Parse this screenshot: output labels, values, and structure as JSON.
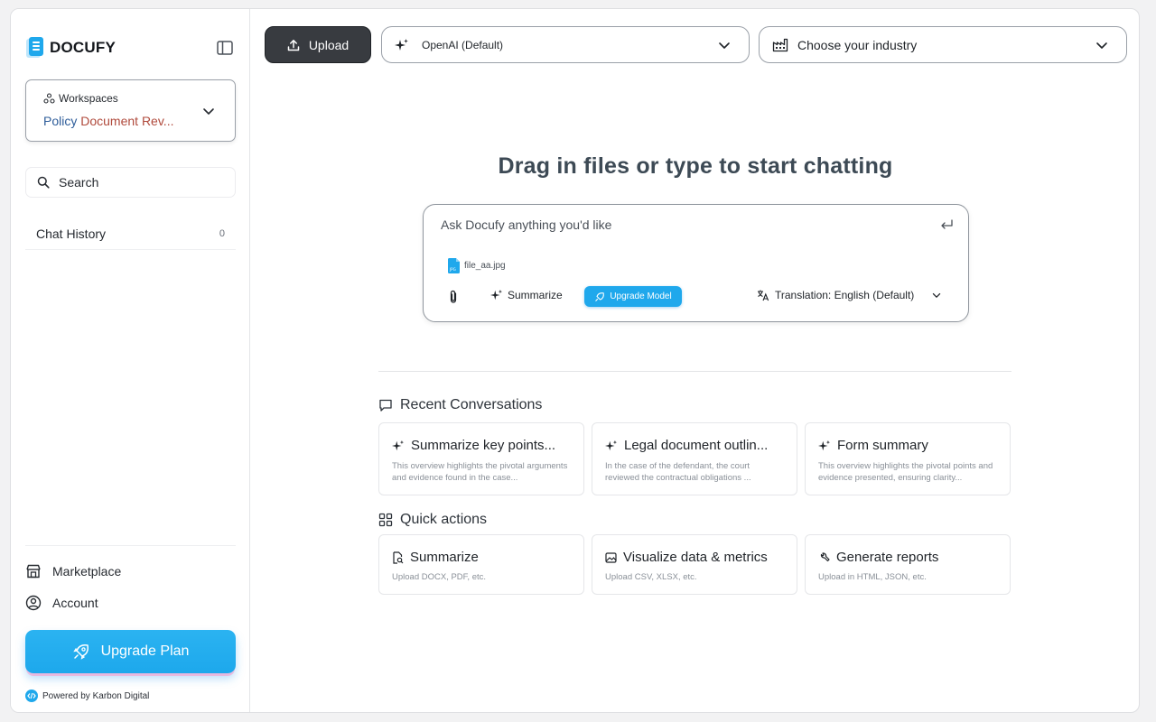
{
  "brand": {
    "name": "DOCUFY"
  },
  "workspace": {
    "label": "Workspaces",
    "name_part1": "Policy",
    "name_part2": "Document Rev..."
  },
  "search": {
    "label": "Search"
  },
  "chat_history": {
    "label": "Chat History",
    "count": "0"
  },
  "nav": {
    "marketplace": "Marketplace",
    "account": "Account"
  },
  "upgrade_plan": {
    "label": "Upgrade Plan"
  },
  "powered_by": "Powered by Karbon Digital",
  "toolbar": {
    "upload_label": "Upload",
    "model_value": "OpenAI (Default)",
    "industry_value": "Choose your industry"
  },
  "headline": "Drag in files or type to start chatting",
  "composer": {
    "placeholder": "Ask Docufy anything you'd like",
    "attachment_name": "file_aa.jpg",
    "summarize_label": "Summarize",
    "upgrade_model_label": "Upgrade Model",
    "translation_label": "Translation: English (Default)"
  },
  "recent": {
    "title": "Recent Conversations",
    "cards": [
      {
        "title": "Summarize key points...",
        "desc": "This overview highlights the pivotal arguments and evidence found in the case..."
      },
      {
        "title": "Legal document outlin...",
        "desc": "In the case of the defendant, the court reviewed the contractual obligations ..."
      },
      {
        "title": "Form summary",
        "desc": "This overview highlights the pivotal points and evidence presented, ensuring clarity..."
      }
    ]
  },
  "quick_actions": {
    "title": "Quick actions",
    "cards": [
      {
        "title": "Summarize",
        "desc": "Upload DOCX, PDF, etc.",
        "icon": "doc-search-icon"
      },
      {
        "title": "Visualize data & metrics",
        "desc": "Upload CSV, XLSX, etc.",
        "icon": "image-icon"
      },
      {
        "title": "Generate reports",
        "desc": "Upload in HTML, JSON, etc.",
        "icon": "wrench-icon"
      }
    ]
  },
  "colors": {
    "accent": "#1fa8ec",
    "upload_button": "#383b40",
    "workspace_name": "#b04a3c"
  }
}
